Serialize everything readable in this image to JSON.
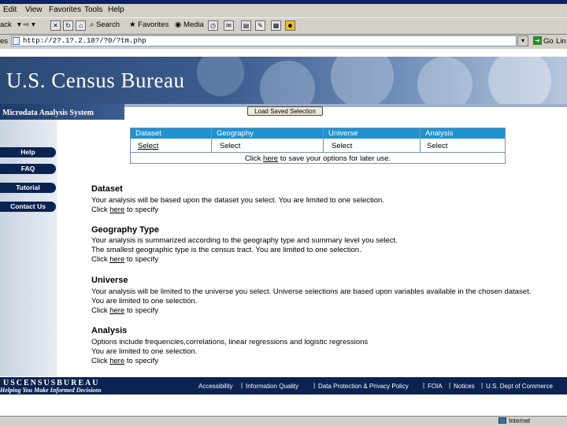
{
  "browser": {
    "menu": [
      "Edit",
      "View",
      "Favorites",
      "Tools",
      "Help"
    ],
    "toolbar": {
      "back": "ack",
      "search": "Search",
      "favorites": "Favorites",
      "media": "Media"
    },
    "address_label": "es",
    "address_value": "http://2?.1?.2.18?/?0/?tm.php",
    "go_label": "Go",
    "links_label": "Lin",
    "status_zone": "Internet"
  },
  "banner": {
    "title": "U.S. Census Bureau",
    "subtitle": "Microdata Analysis System"
  },
  "load_button_label": "Load Saved Selection",
  "sidebar": {
    "items": [
      "Help",
      "FAQ",
      "Tutorial",
      "Contact Us"
    ]
  },
  "selection_table": {
    "headers": [
      "Dataset",
      "Geography",
      "Universe",
      "Analysis"
    ],
    "values": [
      "Select",
      "Select",
      "Select",
      "Select"
    ],
    "save_note_pre": "Click",
    "save_note_link": "here",
    "save_note_post": "to save your options for later use."
  },
  "sections": [
    {
      "heading": "Dataset",
      "lines": [
        "Your analysis will be based upon the dataset you select. You are limited to one selection."
      ],
      "click_pre": "Click",
      "click_link": "here",
      "click_post": "to specify"
    },
    {
      "heading": "Geography Type",
      "lines": [
        "Your analysis is summarized according to the geography type and summary level you select.",
        "The smallest geographic type is the census tract. You are limited to one selection."
      ],
      "click_pre": "Click",
      "click_link": "here",
      "click_post": "to specify"
    },
    {
      "heading": "Universe",
      "lines": [
        "Your analysis will be limited to the universe you select. Universe selections are based upon variables available in the chosen dataset.",
        "You are limited to one selection."
      ],
      "click_pre": "Click",
      "click_link": "here",
      "click_post": "to specify"
    },
    {
      "heading": "Analysis",
      "lines": [
        "Options include frequencies,correlations, linear regressions and logistic regressions",
        "You are limited to one selection."
      ],
      "click_pre": "Click",
      "click_link": "here",
      "click_post": "to specify"
    }
  ],
  "footer": {
    "logo": "USCENSUSBUREAU",
    "tagline": "Helping You Make Informed Decisions",
    "links": [
      "Accessibility",
      "Information Quality",
      "Data Protection & Privacy Policy",
      "FOIA",
      "Notices",
      "U.S. Dept of Commerce"
    ]
  },
  "colors": {
    "header_blue": "#1f93d2",
    "nav_navy": "#0b2350",
    "banner_blue": "#2d4a76"
  }
}
